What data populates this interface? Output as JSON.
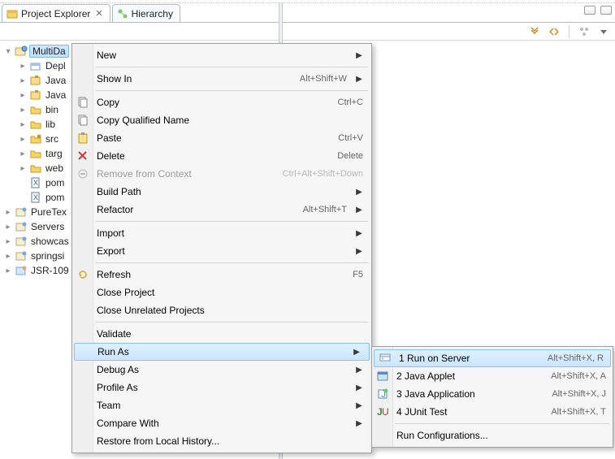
{
  "tabs": {
    "project_explorer": "Project Explorer",
    "hierarchy": "Hierarchy"
  },
  "tree": {
    "root": {
      "label": "MultiDa"
    },
    "children": [
      {
        "label": "Depl",
        "icon": "deploy"
      },
      {
        "label": "Java",
        "icon": "package"
      },
      {
        "label": "Java",
        "icon": "package"
      },
      {
        "label": "bin",
        "icon": "folder"
      },
      {
        "label": "lib",
        "icon": "folder"
      },
      {
        "label": "src",
        "icon": "folder-src"
      },
      {
        "label": "targ",
        "icon": "folder"
      },
      {
        "label": "web",
        "icon": "folder"
      },
      {
        "label": "pom",
        "icon": "xml"
      },
      {
        "label": "pom",
        "icon": "xml"
      }
    ],
    "siblings": [
      {
        "label": "PureTex",
        "icon": "project"
      },
      {
        "label": "Servers",
        "icon": "project"
      },
      {
        "label": "showcas",
        "icon": "project"
      },
      {
        "label": "springsi",
        "icon": "project"
      },
      {
        "label": "JSR-109",
        "icon": "ear"
      }
    ]
  },
  "context_menu": [
    {
      "t": "item",
      "label": "New",
      "arrow": true
    },
    {
      "t": "sep"
    },
    {
      "t": "item",
      "label": "Show In",
      "accel": "Alt+Shift+W",
      "arrow": true
    },
    {
      "t": "sep"
    },
    {
      "t": "item",
      "label": "Copy",
      "accel": "Ctrl+C",
      "icon": "copy"
    },
    {
      "t": "item",
      "label": "Copy Qualified Name",
      "icon": "copy"
    },
    {
      "t": "item",
      "label": "Paste",
      "accel": "Ctrl+V",
      "icon": "paste"
    },
    {
      "t": "item",
      "label": "Delete",
      "accel": "Delete",
      "icon": "delete"
    },
    {
      "t": "item",
      "label": "Remove from Context",
      "accel": "Ctrl+Alt+Shift+Down",
      "disabled": true,
      "icon": "remove"
    },
    {
      "t": "item",
      "label": "Build Path",
      "arrow": true
    },
    {
      "t": "item",
      "label": "Refactor",
      "accel": "Alt+Shift+T",
      "arrow": true
    },
    {
      "t": "sep"
    },
    {
      "t": "item",
      "label": "Import",
      "arrow": true
    },
    {
      "t": "item",
      "label": "Export",
      "arrow": true
    },
    {
      "t": "sep"
    },
    {
      "t": "item",
      "label": "Refresh",
      "accel": "F5",
      "icon": "refresh"
    },
    {
      "t": "item",
      "label": "Close Project"
    },
    {
      "t": "item",
      "label": "Close Unrelated Projects"
    },
    {
      "t": "sep"
    },
    {
      "t": "item",
      "label": "Validate"
    },
    {
      "t": "item",
      "label": "Run As",
      "arrow": true,
      "hover": true
    },
    {
      "t": "item",
      "label": "Debug As",
      "arrow": true
    },
    {
      "t": "item",
      "label": "Profile As",
      "arrow": true
    },
    {
      "t": "item",
      "label": "Team",
      "arrow": true
    },
    {
      "t": "item",
      "label": "Compare With",
      "arrow": true
    },
    {
      "t": "item",
      "label": "Restore from Local History..."
    }
  ],
  "run_as_submenu": [
    {
      "label": "1 Run on Server",
      "accel": "Alt+Shift+X, R",
      "icon": "server",
      "hover": true
    },
    {
      "label": "2 Java Applet",
      "accel": "Alt+Shift+X, A",
      "icon": "applet"
    },
    {
      "label": "3 Java Application",
      "accel": "Alt+Shift+X, J",
      "icon": "javaapp"
    },
    {
      "label": "4 JUnit Test",
      "accel": "Alt+Shift+X, T",
      "icon": "junit"
    },
    {
      "sep": true
    },
    {
      "label": "Run Configurations..."
    }
  ]
}
